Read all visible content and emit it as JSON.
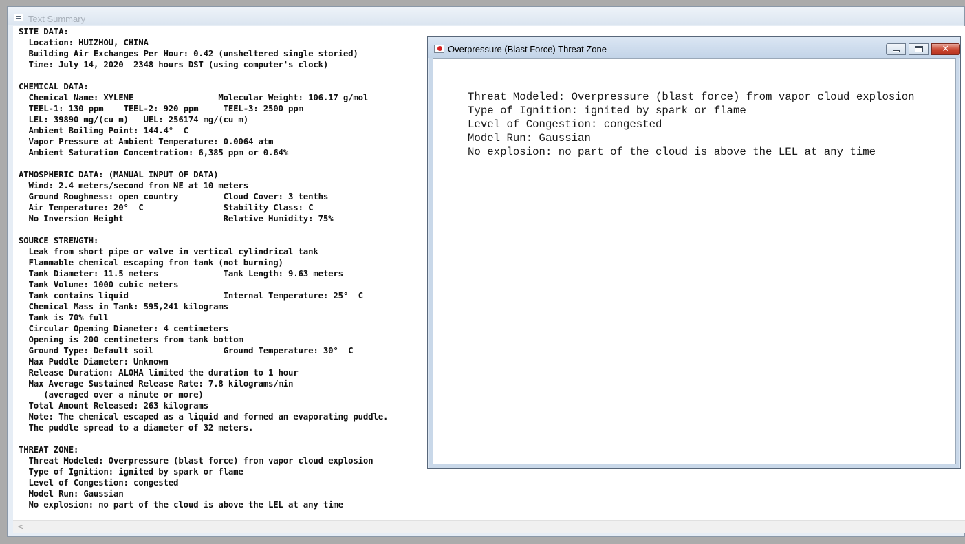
{
  "main_window": {
    "title": "Text Summary",
    "summary_lines": [
      "SITE DATA:",
      "  Location: HUIZHOU, CHINA",
      "  Building Air Exchanges Per Hour: 0.42 (unsheltered single storied)",
      "  Time: July 14, 2020  2348 hours DST (using computer's clock)",
      "",
      "CHEMICAL DATA:",
      "  Chemical Name: XYLENE                 Molecular Weight: 106.17 g/mol",
      "  TEEL-1: 130 ppm    TEEL-2: 920 ppm     TEEL-3: 2500 ppm",
      "  LEL: 39890 mg/(cu m)   UEL: 256174 mg/(cu m)",
      "  Ambient Boiling Point: 144.4°  C",
      "  Vapor Pressure at Ambient Temperature: 0.0064 atm",
      "  Ambient Saturation Concentration: 6,385 ppm or 0.64%",
      "",
      "ATMOSPHERIC DATA: (MANUAL INPUT OF DATA)",
      "  Wind: 2.4 meters/second from NE at 10 meters",
      "  Ground Roughness: open country         Cloud Cover: 3 tenths",
      "  Air Temperature: 20°  C                Stability Class: C",
      "  No Inversion Height                    Relative Humidity: 75%",
      "",
      "SOURCE STRENGTH:",
      "  Leak from short pipe or valve in vertical cylindrical tank",
      "  Flammable chemical escaping from tank (not burning)",
      "  Tank Diameter: 11.5 meters             Tank Length: 9.63 meters",
      "  Tank Volume: 1000 cubic meters",
      "  Tank contains liquid                   Internal Temperature: 25°  C",
      "  Chemical Mass in Tank: 595,241 kilograms",
      "  Tank is 70% full",
      "  Circular Opening Diameter: 4 centimeters",
      "  Opening is 200 centimeters from tank bottom",
      "  Ground Type: Default soil              Ground Temperature: 30°  C",
      "  Max Puddle Diameter: Unknown",
      "  Release Duration: ALOHA limited the duration to 1 hour",
      "  Max Average Sustained Release Rate: 7.8 kilograms/min",
      "     (averaged over a minute or more)",
      "  Total Amount Released: 263 kilograms",
      "  Note: The chemical escaped as a liquid and formed an evaporating puddle.",
      "  The puddle spread to a diameter of 32 meters.",
      "",
      "THREAT ZONE:",
      "  Threat Modeled: Overpressure (blast force) from vapor cloud explosion",
      "  Type of Ignition: ignited by spark or flame",
      "  Level of Congestion: congested",
      "  Model Run: Gaussian",
      "  No explosion: no part of the cloud is above the LEL at any time"
    ],
    "scroll_left_glyph": "<"
  },
  "sub_window": {
    "title": "Overpressure (Blast Force) Threat Zone",
    "close_glyph": "✕",
    "lines": [
      "Threat Modeled: Overpressure (blast force) from vapor cloud explosion",
      "Type of Ignition: ignited by spark or flame",
      "Level of Congestion: congested",
      "Model Run: Gaussian",
      "No explosion: no part of the cloud is above the LEL at any time"
    ]
  },
  "colors": {
    "desktop": "#ababab",
    "close_button": "#c8452f",
    "window_frame": "#c9d8e9"
  }
}
